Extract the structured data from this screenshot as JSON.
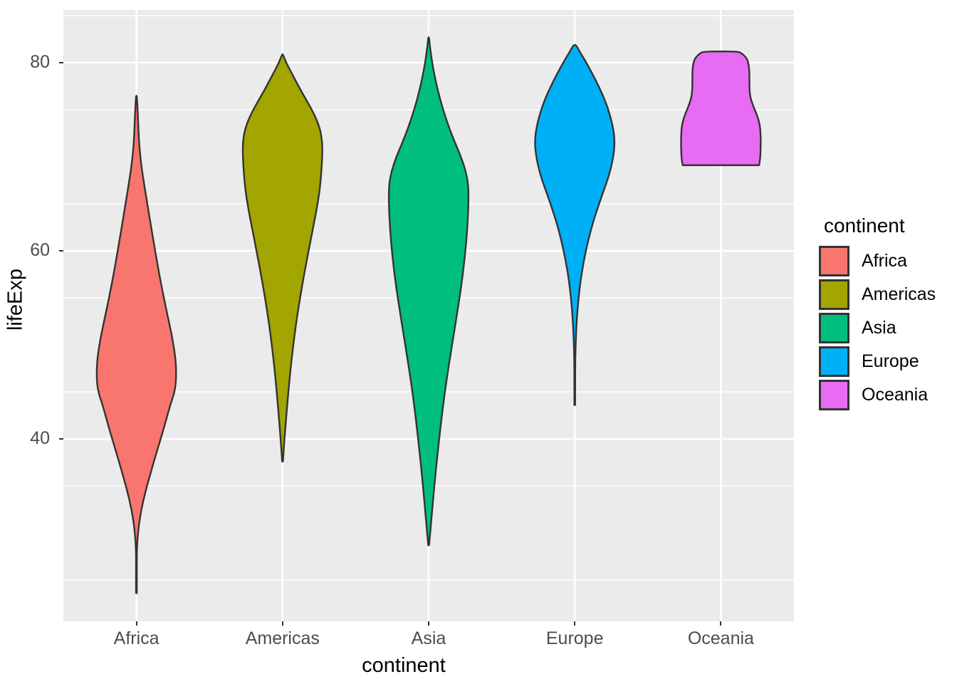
{
  "chart_data": {
    "type": "violin",
    "title": "",
    "xlabel": "continent",
    "ylabel": "lifeExp",
    "grid": true,
    "legend_position": "right",
    "legend_title": "continent",
    "x_categories": [
      "Africa",
      "Americas",
      "Asia",
      "Europe",
      "Oceania"
    ],
    "x_tick_labels": [
      "Africa",
      "Americas",
      "Asia",
      "Europe",
      "Oceania"
    ],
    "y_tick_labels": [
      "80",
      "60",
      "40"
    ],
    "y_tick_values": [
      80,
      60,
      40
    ],
    "ylim": [
      22.5,
      87.0
    ],
    "minor_gridlines_y": [
      85,
      75,
      65,
      55,
      45,
      35,
      25
    ],
    "series": [
      {
        "name": "Africa",
        "color": "#F8766D",
        "min": 23.6,
        "max": 76.5,
        "mode": 45.0,
        "median": 47.8,
        "density": [
          [
            23.6,
            0.003
          ],
          [
            26.0,
            0.004
          ],
          [
            28.5,
            0.01
          ],
          [
            31.0,
            0.06
          ],
          [
            33.5,
            0.17
          ],
          [
            36.0,
            0.33
          ],
          [
            38.5,
            0.5
          ],
          [
            41.0,
            0.68
          ],
          [
            43.5,
            0.84
          ],
          [
            45.0,
            0.96
          ],
          [
            46.5,
            1.0
          ],
          [
            48.5,
            0.985
          ],
          [
            51.0,
            0.89
          ],
          [
            53.5,
            0.76
          ],
          [
            56.0,
            0.64
          ],
          [
            58.5,
            0.53
          ],
          [
            61.0,
            0.43
          ],
          [
            63.5,
            0.33
          ],
          [
            66.0,
            0.235
          ],
          [
            68.5,
            0.14
          ],
          [
            70.5,
            0.085
          ],
          [
            72.0,
            0.06
          ],
          [
            73.5,
            0.045
          ],
          [
            75.0,
            0.03
          ],
          [
            76.5,
            0.01
          ]
        ]
      },
      {
        "name": "Americas",
        "color": "#A3A500",
        "min": 37.6,
        "max": 80.9,
        "mode": 71.5,
        "median": 67.0,
        "density": [
          [
            37.6,
            0.01
          ],
          [
            39.5,
            0.04
          ],
          [
            42.0,
            0.085
          ],
          [
            44.5,
            0.135
          ],
          [
            47.0,
            0.19
          ],
          [
            49.5,
            0.255
          ],
          [
            52.0,
            0.33
          ],
          [
            54.5,
            0.42
          ],
          [
            57.0,
            0.52
          ],
          [
            59.5,
            0.63
          ],
          [
            62.0,
            0.745
          ],
          [
            64.5,
            0.86
          ],
          [
            66.5,
            0.935
          ],
          [
            68.5,
            0.975
          ],
          [
            70.0,
            0.995
          ],
          [
            71.5,
            1.0
          ],
          [
            73.0,
            0.94
          ],
          [
            74.5,
            0.8
          ],
          [
            76.0,
            0.6
          ],
          [
            77.5,
            0.4
          ],
          [
            79.0,
            0.215
          ],
          [
            80.0,
            0.09
          ],
          [
            80.9,
            0.01
          ]
        ]
      },
      {
        "name": "Asia",
        "color": "#00BF7D",
        "min": 28.7,
        "max": 82.7,
        "mode": 67.0,
        "median": 61.8,
        "density": [
          [
            28.7,
            0.01
          ],
          [
            31.0,
            0.06
          ],
          [
            33.5,
            0.11
          ],
          [
            36.0,
            0.165
          ],
          [
            38.5,
            0.225
          ],
          [
            41.0,
            0.29
          ],
          [
            43.5,
            0.36
          ],
          [
            46.0,
            0.44
          ],
          [
            48.5,
            0.53
          ],
          [
            51.0,
            0.625
          ],
          [
            53.5,
            0.72
          ],
          [
            56.0,
            0.81
          ],
          [
            58.5,
            0.885
          ],
          [
            61.0,
            0.945
          ],
          [
            63.5,
            0.985
          ],
          [
            65.5,
            1.0
          ],
          [
            67.0,
            0.995
          ],
          [
            68.5,
            0.93
          ],
          [
            70.0,
            0.81
          ],
          [
            71.5,
            0.66
          ],
          [
            73.0,
            0.52
          ],
          [
            74.5,
            0.4
          ],
          [
            76.0,
            0.295
          ],
          [
            77.5,
            0.205
          ],
          [
            79.0,
            0.13
          ],
          [
            80.5,
            0.07
          ],
          [
            82.0,
            0.025
          ],
          [
            82.7,
            0.008
          ]
        ]
      },
      {
        "name": "Europe",
        "color": "#00B0F6",
        "min": 43.6,
        "max": 81.9,
        "mode": 71.8,
        "median": 72.2,
        "density": [
          [
            43.6,
            0.004
          ],
          [
            46.0,
            0.006
          ],
          [
            48.5,
            0.012
          ],
          [
            51.0,
            0.03
          ],
          [
            53.0,
            0.055
          ],
          [
            55.0,
            0.095
          ],
          [
            57.0,
            0.15
          ],
          [
            59.0,
            0.23
          ],
          [
            61.0,
            0.33
          ],
          [
            63.0,
            0.455
          ],
          [
            64.5,
            0.57
          ],
          [
            66.0,
            0.69
          ],
          [
            67.5,
            0.82
          ],
          [
            69.0,
            0.92
          ],
          [
            70.5,
            0.985
          ],
          [
            71.8,
            1.0
          ],
          [
            73.0,
            0.965
          ],
          [
            74.5,
            0.88
          ],
          [
            76.0,
            0.76
          ],
          [
            77.5,
            0.6
          ],
          [
            79.0,
            0.42
          ],
          [
            80.3,
            0.25
          ],
          [
            81.2,
            0.12
          ],
          [
            81.9,
            0.03
          ]
        ]
      },
      {
        "name": "Oceania",
        "color": "#E76BF3",
        "min": 69.1,
        "max": 81.2,
        "mode": 73.0,
        "median": 73.7,
        "density": [
          [
            69.1,
            0.96
          ],
          [
            69.8,
            0.985
          ],
          [
            70.5,
            0.995
          ],
          [
            71.5,
            1.0
          ],
          [
            72.5,
            0.995
          ],
          [
            73.5,
            0.975
          ],
          [
            74.5,
            0.9
          ],
          [
            75.5,
            0.8
          ],
          [
            76.3,
            0.74
          ],
          [
            77.0,
            0.72
          ],
          [
            78.0,
            0.715
          ],
          [
            79.0,
            0.715
          ],
          [
            79.8,
            0.7
          ],
          [
            80.5,
            0.65
          ],
          [
            81.0,
            0.52
          ],
          [
            81.2,
            0.43
          ]
        ]
      }
    ]
  },
  "legend": {
    "title": "continent",
    "items": [
      {
        "label": "Africa",
        "color": "#F8766D"
      },
      {
        "label": "Americas",
        "color": "#A3A500"
      },
      {
        "label": "Asia",
        "color": "#00BF7D"
      },
      {
        "label": "Europe",
        "color": "#00B0F6"
      },
      {
        "label": "Oceania",
        "color": "#E76BF3"
      }
    ]
  },
  "axes": {
    "x_title": "continent",
    "y_title": "lifeExp",
    "y_ticks": [
      "80",
      "60",
      "40"
    ],
    "x_ticks": [
      "Africa",
      "Americas",
      "Asia",
      "Europe",
      "Oceania"
    ]
  },
  "theme": {
    "panel_background": "#EBEBEB",
    "gridline_major": "#FFFFFF",
    "gridline_minor": "#FFFFFF",
    "outline": "#333333",
    "axis_text": "#4D4D4D",
    "axis_title": "#000000",
    "plot_background": "#FFFFFF"
  }
}
